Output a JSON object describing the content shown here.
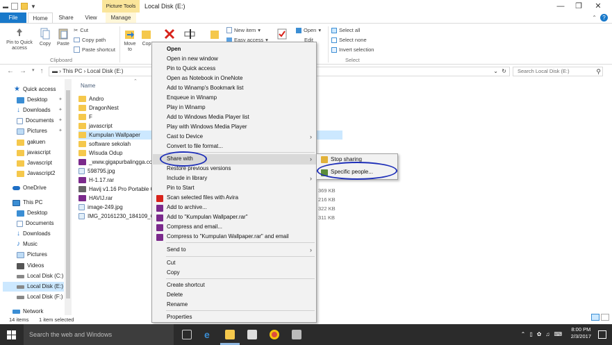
{
  "window": {
    "title": "Local Disk (E:)",
    "context_tab_title": "Picture Tools",
    "controls": [
      "—",
      "❐",
      "✕"
    ]
  },
  "ribbon": {
    "tabs": [
      "File",
      "Home",
      "Share",
      "View",
      "Manage"
    ],
    "clipboard": {
      "pin_label": "Pin to Quick access",
      "copy_label": "Copy",
      "paste_label": "Paste",
      "cut_label": "Cut",
      "copy_path_label": "Copy path",
      "paste_shortcut_label": "Paste shortcut",
      "group_label": "Clipboard"
    },
    "organize": {
      "move_label": "Move to",
      "copy_label": "Cop"
    },
    "new": {
      "new_item_label": "New item",
      "easy_access_label": "Easy access"
    },
    "open": {
      "open_label": "Open",
      "edit_label": "Edit"
    },
    "select": {
      "select_all_label": "Select all",
      "select_none_label": "Select none",
      "invert_label": "Invert selection",
      "group_label": "Select"
    }
  },
  "address": {
    "breadcrumb": [
      "This PC",
      "Local Disk (E:)"
    ],
    "search_placeholder": "Search Local Disk (E:)"
  },
  "nav": {
    "items": [
      {
        "label": "Quick access",
        "icon": "star-icon"
      },
      {
        "label": "Desktop",
        "icon": "desktop-icon",
        "pinned": true
      },
      {
        "label": "Downloads",
        "icon": "downloads-icon",
        "pinned": true
      },
      {
        "label": "Documents",
        "icon": "documents-icon",
        "pinned": true
      },
      {
        "label": "Pictures",
        "icon": "pictures-icon",
        "pinned": true
      },
      {
        "label": "gakuen",
        "icon": "folder-icon"
      },
      {
        "label": "javascript",
        "icon": "folder-icon"
      },
      {
        "label": "Javascript",
        "icon": "folder-icon"
      },
      {
        "label": "Javascript2",
        "icon": "folder-icon"
      },
      {
        "label": "OneDrive",
        "icon": "onedrive-icon"
      },
      {
        "label": "This PC",
        "icon": "pc-icon"
      },
      {
        "label": "Desktop",
        "icon": "desktop-icon"
      },
      {
        "label": "Documents",
        "icon": "documents-icon"
      },
      {
        "label": "Downloads",
        "icon": "downloads-icon"
      },
      {
        "label": "Music",
        "icon": "music-icon"
      },
      {
        "label": "Pictures",
        "icon": "pictures-icon"
      },
      {
        "label": "Videos",
        "icon": "videos-icon"
      },
      {
        "label": "Local Disk (C:)",
        "icon": "drive-icon"
      },
      {
        "label": "Local Disk (E:)",
        "icon": "drive-icon",
        "selected": true
      },
      {
        "label": "Local Disk (F:)",
        "icon": "drive-icon"
      },
      {
        "label": "Network",
        "icon": "network-icon"
      }
    ]
  },
  "files": {
    "column_name": "Name",
    "items": [
      {
        "name": "Andro",
        "type": "folder"
      },
      {
        "name": "DragonNest",
        "type": "folder"
      },
      {
        "name": "F",
        "type": "folder"
      },
      {
        "name": "javascript",
        "type": "folder"
      },
      {
        "name": "Kumpulan Wallpaper",
        "type": "folder",
        "selected": true
      },
      {
        "name": "software sekolah",
        "type": "folder"
      },
      {
        "name": "Wisuda Odup",
        "type": "folder"
      },
      {
        "name": "_www.gigapurbalingga.co",
        "type": "rar"
      },
      {
        "name": "598795.jpg",
        "type": "image"
      },
      {
        "name": "H-1.17.rar",
        "type": "rar"
      },
      {
        "name": "Havij v1.16 Pro Portable C",
        "type": "exe"
      },
      {
        "name": "HAVIJ.rar",
        "type": "rar"
      },
      {
        "name": "image-249.jpg",
        "type": "image"
      },
      {
        "name": "IMG_20161230_184109_646",
        "type": "image"
      }
    ],
    "sizes": [
      "369 KB",
      "216 KB",
      "322 KB",
      "311 KB"
    ]
  },
  "status": {
    "item_count": "14 items",
    "selected": "1 item selected"
  },
  "context_menu": {
    "items": [
      "Open",
      "Open in new window",
      "Pin to Quick access",
      "Open as Notebook in OneNote",
      "Add to Winamp's Bookmark list",
      "Enqueue in Winamp",
      "Play in Winamp",
      "Add to Windows Media Player list",
      "Play with Windows Media Player",
      "Cast to Device",
      "Convert to file format...",
      "Share with",
      "Restore previous versions",
      "Include in library",
      "Pin to Start",
      "Scan selected files with Avira",
      "Add to archive...",
      "Add to \"Kumpulan Wallpaper.rar\"",
      "Compress and email...",
      "Compress to \"Kumpulan Wallpaper.rar\" and email",
      "Send to",
      "Cut",
      "Copy",
      "Create shortcut",
      "Delete",
      "Rename",
      "Properties"
    ]
  },
  "submenu": {
    "items": [
      "Stop sharing",
      "Specific people..."
    ]
  },
  "taskbar": {
    "search_placeholder": "Search the web and Windows",
    "time": "8:00 PM",
    "date": "2/3/2017"
  },
  "colors": {
    "accent": "#1979ca",
    "selection": "#cce8ff",
    "annotation": "#1e2fb8",
    "taskbar": "#2b2b2b"
  }
}
